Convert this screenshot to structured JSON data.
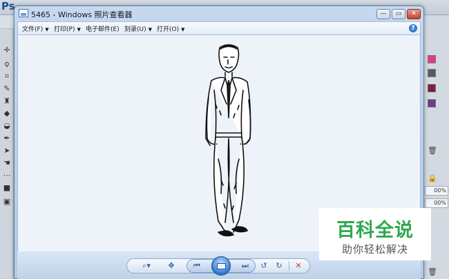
{
  "background_app": {
    "logo": "Ps",
    "zoom_values": [
      "00%",
      "00%"
    ]
  },
  "window": {
    "title": "5465 - Windows 照片查看器",
    "controls": {
      "minimize": "—",
      "maximize": "▭",
      "close": "✕"
    }
  },
  "menu": {
    "items": [
      {
        "label": "文件(F)"
      },
      {
        "label": "打印(P)"
      },
      {
        "label": "电子邮件(E)"
      },
      {
        "label": "刻录(U)"
      },
      {
        "label": "打开(O)"
      }
    ],
    "help": "?"
  },
  "toolbar": {
    "zoom": "⌕▾",
    "actual_size": "✥",
    "previous": "⏮",
    "next": "⏭",
    "rotate_ccw": "↺",
    "rotate_cw": "↻",
    "delete": "✕"
  },
  "watermark": {
    "title": "百科全说",
    "subtitle": "助你轻松解决"
  },
  "colors": {
    "watermark_green": "#2fa84f",
    "delete_red": "#d0312d",
    "viewer_blue": "#2a5fa5"
  }
}
